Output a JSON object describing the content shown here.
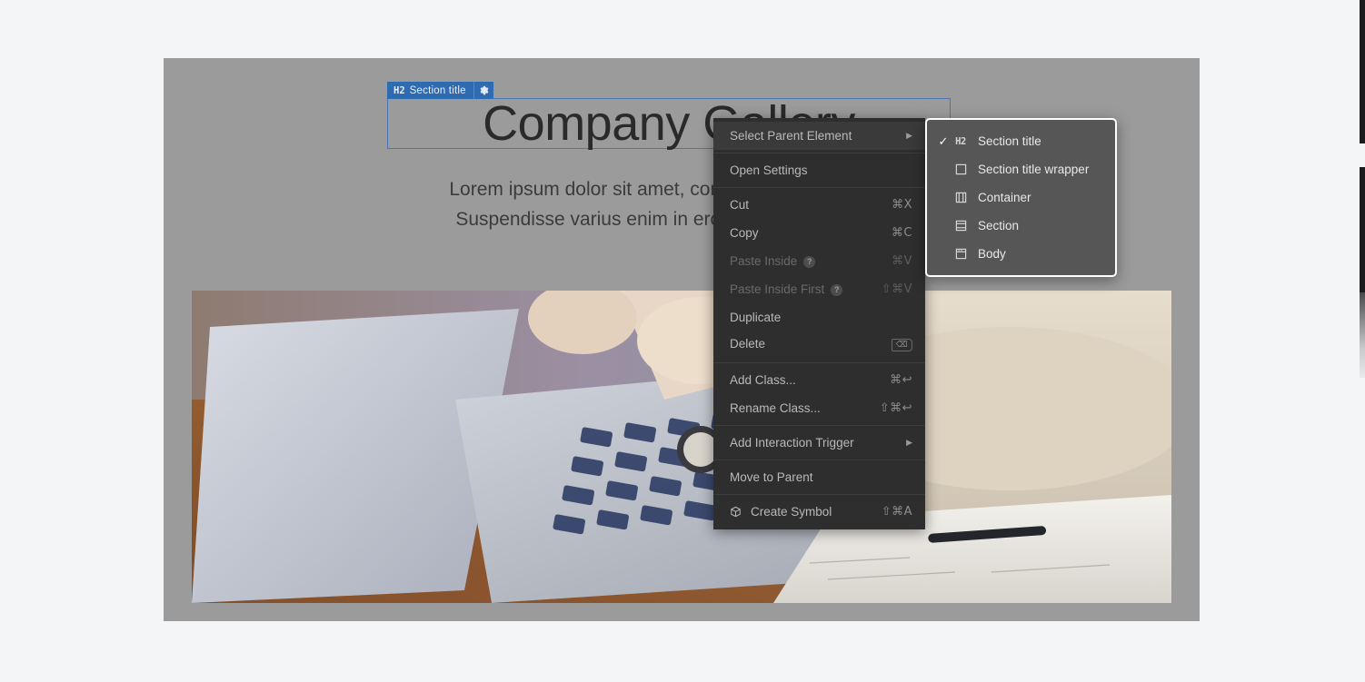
{
  "canvas": {
    "badge": {
      "tag": "H2",
      "label": "Section title",
      "gear_icon": "gear-icon"
    },
    "heading": "Company Gallery",
    "paragraph_line1": "Lorem ipsum dolor sit amet, consectetur adipiscing elit.",
    "paragraph_line2": "Suspendisse varius enim in eros elementum tristique.",
    "photo_alt": "laptop-desk-photo"
  },
  "context_menu": {
    "items": [
      {
        "label": "Select Parent Element",
        "shortcut": "",
        "submenu": true,
        "disabled": false,
        "hover": true
      },
      {
        "label": "Open Settings",
        "shortcut": "",
        "submenu": false,
        "disabled": false,
        "hover": false
      },
      {
        "label": "Cut",
        "shortcut": "⌘X",
        "submenu": false,
        "disabled": false,
        "hover": false
      },
      {
        "label": "Copy",
        "shortcut": "⌘C",
        "submenu": false,
        "disabled": false,
        "hover": false
      },
      {
        "label": "Paste Inside",
        "shortcut": "⌘V",
        "submenu": false,
        "disabled": true,
        "hover": false,
        "help": "?"
      },
      {
        "label": "Paste Inside First",
        "shortcut": "⇧⌘V",
        "submenu": false,
        "disabled": true,
        "hover": false,
        "help": "?"
      },
      {
        "label": "Duplicate",
        "shortcut": "",
        "submenu": false,
        "disabled": false,
        "hover": false
      },
      {
        "label": "Delete",
        "shortcut": "⌫",
        "submenu": false,
        "disabled": false,
        "hover": false
      },
      {
        "label": "Add Class...",
        "shortcut": "⌘↩",
        "submenu": false,
        "disabled": false,
        "hover": false
      },
      {
        "label": "Rename Class...",
        "shortcut": "⇧⌘↩",
        "submenu": false,
        "disabled": false,
        "hover": false
      },
      {
        "label": "Add Interaction Trigger",
        "shortcut": "",
        "submenu": true,
        "disabled": false,
        "hover": false
      },
      {
        "label": "Move to Parent",
        "shortcut": "",
        "submenu": false,
        "disabled": false,
        "hover": false
      },
      {
        "label": "Create Symbol",
        "shortcut": "⇧⌘A",
        "submenu": false,
        "disabled": false,
        "hover": false,
        "icon": "cube-icon"
      }
    ]
  },
  "submenu": {
    "items": [
      {
        "label": "Section title",
        "icon": "h2-icon",
        "checked": true
      },
      {
        "label": "Section title wrapper",
        "icon": "square-icon",
        "checked": false
      },
      {
        "label": "Container",
        "icon": "container-icon",
        "checked": false
      },
      {
        "label": "Section",
        "icon": "section-icon",
        "checked": false
      },
      {
        "label": "Body",
        "icon": "body-icon",
        "checked": false
      }
    ]
  },
  "colors": {
    "page_background": "#f4f5f7",
    "canvas_overlay": "#9b9b9b",
    "badge_blue": "#2e6bb0",
    "menu_background": "#2e2e2e",
    "submenu_background": "#565656"
  }
}
